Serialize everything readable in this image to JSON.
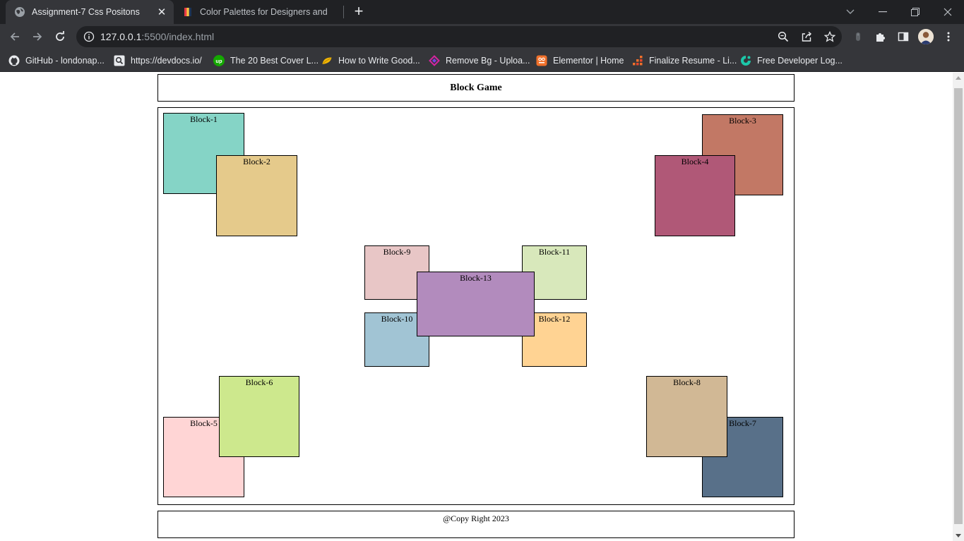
{
  "browser": {
    "tabs": [
      {
        "title": "Assignment-7 Css Positons",
        "active": true,
        "favicon": "globe-icon"
      },
      {
        "title": "Color Palettes for Designers and",
        "active": false,
        "favicon": "coolors-icon"
      }
    ],
    "address": {
      "host": "127.0.0.1",
      "rest": ":5500/index.html"
    },
    "bookmarks": [
      {
        "label": "GitHub - londonap...",
        "icon": "github-icon"
      },
      {
        "label": "https://devdocs.io/",
        "icon": "devdocs-icon"
      },
      {
        "label": "The 20 Best Cover L...",
        "icon": "upwork-icon"
      },
      {
        "label": "How to Write Good...",
        "icon": "taco-icon"
      },
      {
        "label": "Remove Bg - Uploa...",
        "icon": "removebg-icon"
      },
      {
        "label": "Elementor | Home",
        "icon": "elementor-icon"
      },
      {
        "label": "Finalize Resume - Li...",
        "icon": "resume-icon"
      },
      {
        "label": "Free Developer Log...",
        "icon": "logo-icon"
      }
    ]
  },
  "page": {
    "header_title": "Block Game",
    "footer_text": "@Copy Right 2023",
    "blocks": [
      {
        "label": "Block-1",
        "color": "#85d4c6"
      },
      {
        "label": "Block-2",
        "color": "#e5ca8b"
      },
      {
        "label": "Block-3",
        "color": "#c27865"
      },
      {
        "label": "Block-4",
        "color": "#b05877"
      },
      {
        "label": "Block-5",
        "color": "#ffd5d5"
      },
      {
        "label": "Block-6",
        "color": "#cde88d"
      },
      {
        "label": "Block-7",
        "color": "#587089"
      },
      {
        "label": "Block-8",
        "color": "#d1b895"
      },
      {
        "label": "Block-9",
        "color": "#e8c6c6"
      },
      {
        "label": "Block-10",
        "color": "#a1c4d4"
      },
      {
        "label": "Block-11",
        "color": "#d8e8bb"
      },
      {
        "label": "Block-12",
        "color": "#ffd393"
      },
      {
        "label": "Block-13",
        "color": "#b28bbd"
      }
    ]
  }
}
